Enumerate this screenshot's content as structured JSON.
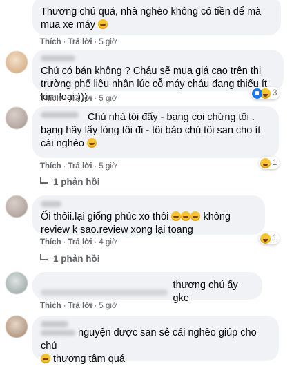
{
  "meta": {
    "like": "Thích",
    "reply": "Trả lời",
    "sep": "·"
  },
  "comments": [
    {
      "text": "Thương chú quá, nhà nghèo không có tiền để mà mua xe máy",
      "time": "5 giờ"
    },
    {
      "text": "Chú có bán không ? Cháu sẽ mua giá cao trên thị trường phế liệu nhân lúc cỗ máy cháu đang thiếu ít kim loại:)))",
      "time": "5 giờ",
      "reaction_count": "3"
    },
    {
      "text": "Chú nhà tôi đấy - bạng coi chừng tôi . bạng hãy lấy lòng tôi đi - tôi bảo chú tôi san cho ít cái nghèo",
      "time": "5 giờ",
      "reaction_count": "1",
      "replies": "1 phản hồi"
    },
    {
      "text": "Ối thôii.lại giống phúc xo thôi",
      "text2": "không review k sao.review xong lại toang",
      "time": "4 giờ",
      "reaction_count": "1",
      "replies": "1 phản hồi"
    },
    {
      "text": "thương chú ấy gke",
      "time": "5 giờ"
    },
    {
      "text": "nguyện được san sẻ cái nghèo giúp cho chú",
      "text2": "thương tâm quá"
    }
  ]
}
